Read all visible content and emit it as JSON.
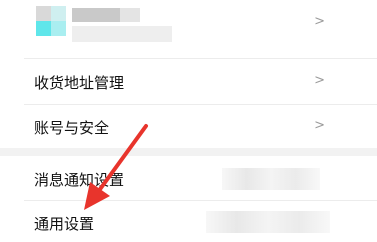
{
  "profile": {
    "avatar_icon": "avatar-image-blurred"
  },
  "menu": {
    "group1": [
      {
        "label": "收货地址管理"
      },
      {
        "label": "账号与安全"
      }
    ],
    "group2": [
      {
        "label": "消息通知设置"
      },
      {
        "label": "通用设置"
      }
    ],
    "chevron_glyph": ">"
  },
  "annotation": {
    "color": "#e8342c",
    "icon": "pointer-arrow-icon"
  }
}
